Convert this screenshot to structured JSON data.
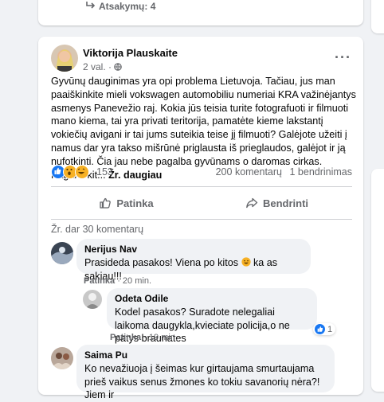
{
  "previous_post": {
    "replies_label": "Atsakymų: 4"
  },
  "post": {
    "author": "Viktorija Plauskaite",
    "time": "2 val. · ",
    "body": "Gyvūnų dauginimas yra opi problema Lietuvoja. Tačiau, jus man paaiškinkite mieli vokswagen automobiliu numeriai KRA važinėjantys asmenys Panevežio raj. Kokia jūs teisia turite fotografuoti ir filmuoti mano kiema, tai yra privati teritorija, pamatėte kieme lakstantį vokiečių avigani ir tai jums suteikia teise jį filmuoti? Galėjote užeiti į namus dar yra takso mišrūnė priglausta iš prieglaudos, galėjot ir ją nufotkinti. Čia jau nebe pagalba gyvūnams o daromas cirkas. Pagalvokit...",
    "see_more": "Žr. daugiau",
    "reaction_count": "153",
    "comment_count": "200 komentarų",
    "share_count": "1 bendrinimas",
    "like_label": "Patinka",
    "share_label": "Bendrinti",
    "view_more_comments": "Žr. dar 30 komentarų"
  },
  "comments": [
    {
      "name": "Nerijus Nav",
      "text": "Prasideda pasakos! Viena po kitos",
      "text_after_emoji": " ka as sakiau!!!",
      "like": "Patinka",
      "time": "· 20 min."
    },
    {
      "name": "Odeta Odile",
      "text": "Kodel pasakos? Suradote nelegaliai laikoma daugykla,kvieciate policija,o ne patys braunates",
      "like": "Patinka",
      "time": "· 19 min.",
      "reaction_count": "1"
    },
    {
      "name": "Saima Pu",
      "text": "Ko nevažiuoja į šeimas kur girtaujama smurtaujama prieš vaikus senus žmones ko tokiu savanorių nėra?! Jiem ir"
    }
  ],
  "colors": {
    "accent": "#1877f2",
    "secondary_text": "#65676b",
    "background": "#f0f2f5"
  }
}
